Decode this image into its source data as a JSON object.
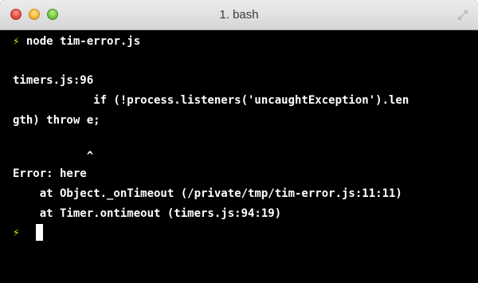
{
  "window": {
    "title": "1. bash"
  },
  "prompt_symbol": "⚡",
  "terminal": {
    "command": "node tim-error.js",
    "lines": [
      "timers.js:96",
      "            if (!process.listeners('uncaughtException').len",
      "gth) throw e;",
      "           ^",
      "Error: here",
      "    at Object._onTimeout (/private/tmp/tim-error.js:11:11)",
      "    at Timer.ontimeout (timers.js:94:19)"
    ]
  },
  "icons": {
    "close": "close-light-icon",
    "minimize": "minimize-light-icon",
    "zoom": "zoom-light-icon",
    "resize": "fullscreen-icon",
    "prompt": "lightning-bolt-icon"
  }
}
